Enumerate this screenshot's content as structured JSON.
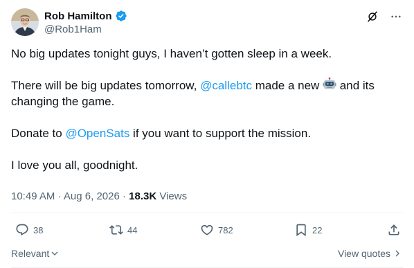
{
  "author": {
    "name": "Rob Hamilton",
    "handle": "@Rob1Ham",
    "avatar_icon": "avatar-portrait",
    "verified_icon": "verified-badge-icon",
    "verified_color": "#1d9bf0"
  },
  "tweet": {
    "p1": "No big updates tonight guys, I haven’t gotten sleep in a week.",
    "p2_before": "There will be big updates tomorrow, ",
    "p2_mention": "@callebtc",
    "p2_middle": " made a new ",
    "p2_emoji": "robot-emoji",
    "p2_after": " and its changing the game.",
    "p3_before": "Donate to ",
    "p3_mention": "@OpenSats",
    "p3_after": " if you want to support the mission.",
    "p4": "I love you all, goodnight."
  },
  "meta": {
    "time": "10:49 AM",
    "sep1": " · ",
    "date": "Aug 6, 2026",
    "sep2": " · ",
    "views_count": "18.3K",
    "views_label": " Views"
  },
  "actions": {
    "replies": "38",
    "reposts": "44",
    "likes": "782",
    "bookmarks": "22"
  },
  "footer": {
    "sort_label": "Relevant",
    "view_quotes": "View quotes"
  },
  "colors": {
    "accent": "#1d9bf0",
    "text": "#0f1419",
    "muted": "#536471",
    "divider": "#eff3f4"
  }
}
